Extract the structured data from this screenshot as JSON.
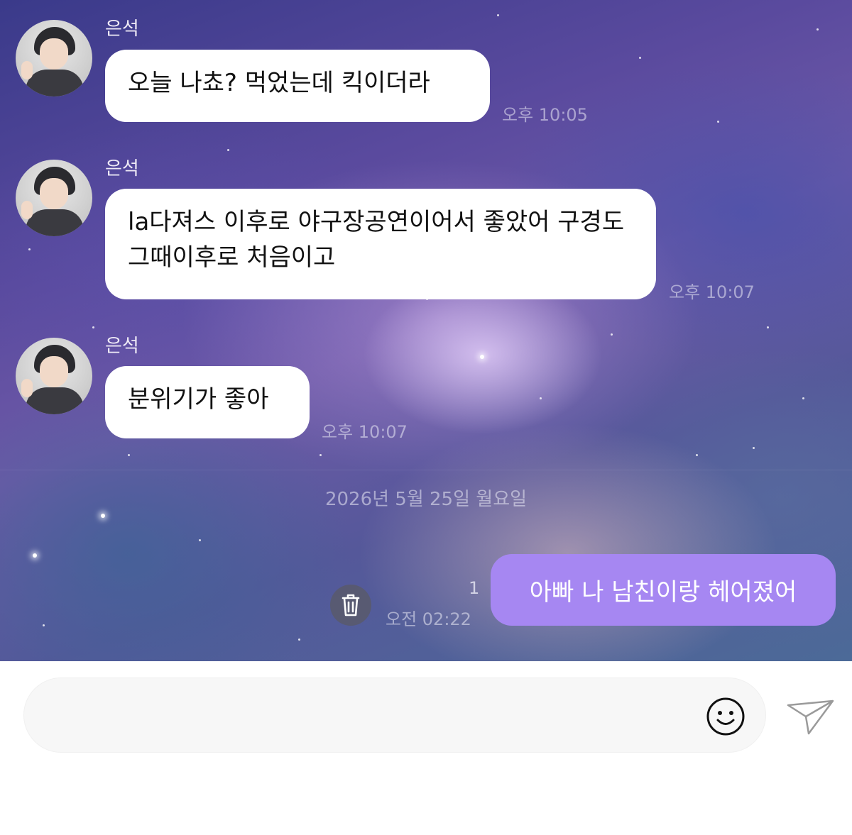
{
  "colors": {
    "my_bubble": "#a687f2",
    "their_bubble": "#ffffff",
    "input_bg": "#f7f7f7"
  },
  "messages": [
    {
      "sender": "은석",
      "text": "오늘 나쵸? 먹었는데 킥이더라",
      "time": "오후 10:05"
    },
    {
      "sender": "은석",
      "text": "la다져스 이후로 야구장공연이어서 좋았어 구경도 그때이후로 처음이고",
      "time": "오후 10:07"
    },
    {
      "sender": "은석",
      "text": "분위기가 좋아",
      "time": "오후 10:07"
    }
  ],
  "date_separator": "2026년 5월 25일 월요일",
  "my_message": {
    "text": "아빠 나 남친이랑 헤어졌어",
    "unread": "1",
    "time": "오전 02:22"
  },
  "composer": {
    "placeholder": "",
    "emoji_icon": "smiley-icon",
    "send_icon": "paper-plane-icon",
    "trash_icon": "trash-icon"
  }
}
